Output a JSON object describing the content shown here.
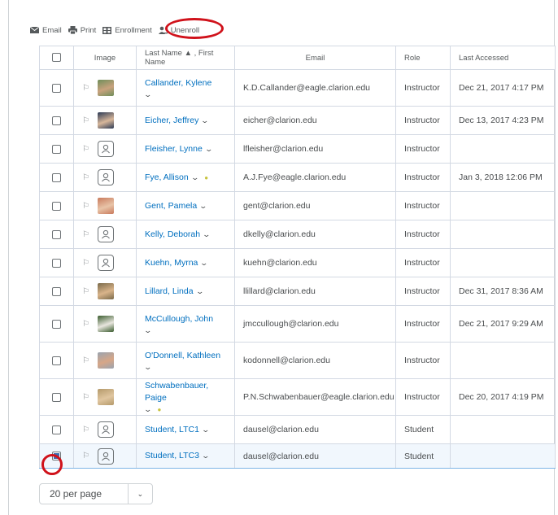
{
  "toolbar": {
    "email": "Email",
    "print": "Print",
    "enrollment": "Enrollment",
    "unenroll": "Unenroll"
  },
  "columns": {
    "image": "Image",
    "name": "Last Name ▲ , First Name",
    "email": "Email",
    "role": "Role",
    "last_accessed": "Last Accessed"
  },
  "rows": [
    {
      "name": "Callander, Kylene",
      "email": "K.D.Callander@eagle.clarion.edu",
      "role": "Instructor",
      "last": "Dec 21, 2017 4:17 PM"
    },
    {
      "name": "Eicher, Jeffrey",
      "email": "eicher@clarion.edu",
      "role": "Instructor",
      "last": "Dec 13, 2017 4:23 PM"
    },
    {
      "name": "Fleisher, Lynne",
      "email": "lfleisher@clarion.edu",
      "role": "Instructor",
      "last": ""
    },
    {
      "name": "Fye, Allison",
      "email": "A.J.Fye@eagle.clarion.edu",
      "role": "Instructor",
      "last": "Jan 3, 2018 12:06 PM"
    },
    {
      "name": "Gent, Pamela",
      "email": "gent@clarion.edu",
      "role": "Instructor",
      "last": ""
    },
    {
      "name": "Kelly, Deborah",
      "email": "dkelly@clarion.edu",
      "role": "Instructor",
      "last": ""
    },
    {
      "name": "Kuehn, Myrna",
      "email": "kuehn@clarion.edu",
      "role": "Instructor",
      "last": ""
    },
    {
      "name": "Lillard, Linda",
      "email": "llillard@clarion.edu",
      "role": "Instructor",
      "last": "Dec 31, 2017 8:36 AM"
    },
    {
      "name": "McCullough, John",
      "email": "jmccullough@clarion.edu",
      "role": "Instructor",
      "last": "Dec 21, 2017 9:29 AM"
    },
    {
      "name": "O'Donnell, Kathleen",
      "email": "kodonnell@clarion.edu",
      "role": "Instructor",
      "last": ""
    },
    {
      "name": "Schwabenbauer, Paige",
      "email": "P.N.Schwabenbauer@eagle.clarion.edu",
      "role": "Instructor",
      "last": "Dec 20, 2017 4:19 PM"
    },
    {
      "name": "Student, LTC1",
      "email": "dausel@clarion.edu",
      "role": "Student",
      "last": ""
    },
    {
      "name": "Student, LTC3",
      "email": "dausel@clarion.edu",
      "role": "Student",
      "last": ""
    }
  ],
  "pager": {
    "per_page": "20 per page"
  },
  "colors": {
    "link": "#006fbf",
    "highlight": "#d0121b",
    "selected_row": "#f1f7fd"
  }
}
